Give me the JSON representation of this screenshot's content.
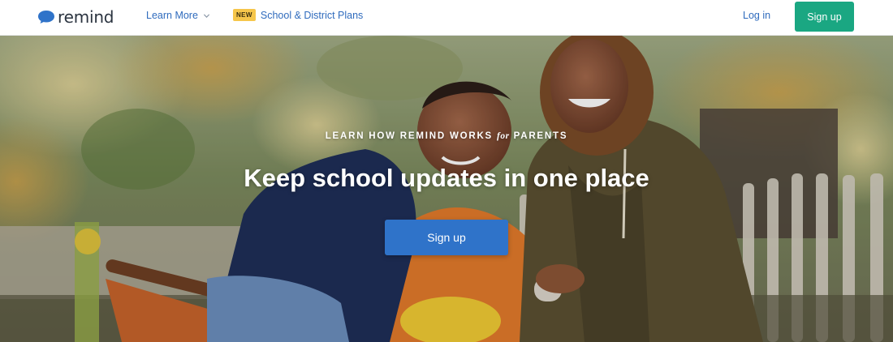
{
  "brand": {
    "name": "remind",
    "logo_icon": "speech-bubble-icon",
    "color": "#2f73c9"
  },
  "nav": {
    "learn_more": "Learn More",
    "learn_more_icon": "chevron-down-icon",
    "badge": "NEW",
    "plans": "School & District Plans",
    "login": "Log in",
    "signup": "Sign up"
  },
  "hero": {
    "kicker_prefix": "LEARN HOW REMIND WORKS",
    "kicker_em": "for",
    "kicker_suffix": "PARENTS",
    "headline": "Keep school updates in one place",
    "cta": "Sign up"
  },
  "colors": {
    "link": "#2f6bbd",
    "signup_green": "#1aa782",
    "cta_blue": "#2f73c9",
    "badge_yellow": "#f6c64b"
  }
}
